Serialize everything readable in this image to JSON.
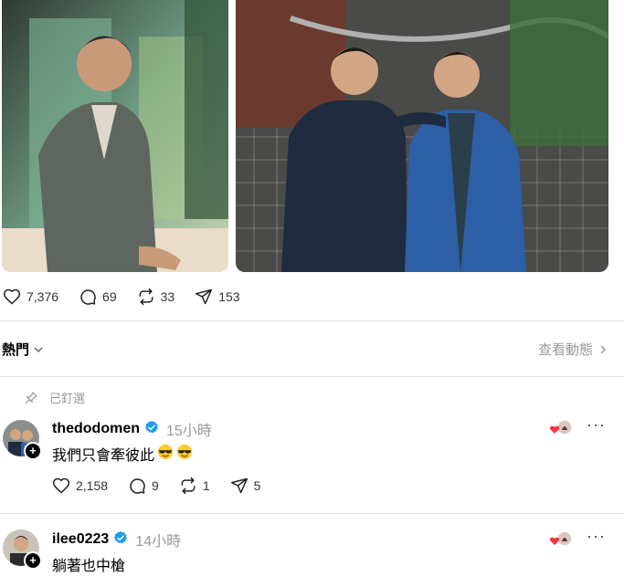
{
  "post": {
    "images": [
      {
        "alt_icon": "photo-man-gray-blazer"
      },
      {
        "alt_icon": "photo-two-men-brick-wall"
      }
    ],
    "actions": {
      "likes": "7,376",
      "comments": "69",
      "reposts": "33",
      "shares": "153"
    }
  },
  "replies_header": {
    "sort_label": "熱門",
    "view_activity_label": "查看動態"
  },
  "pinned": {
    "label": "已釘選"
  },
  "comments": [
    {
      "username": "thedodomen",
      "time": "15小時",
      "text": "我們只會牽彼此",
      "emojis": [
        "sunglasses-face",
        "sunglasses-face"
      ],
      "actions": {
        "likes": "2,158",
        "comments": "9",
        "reposts": "1",
        "shares": "5"
      }
    },
    {
      "username": "ilee0223",
      "time": "14小時",
      "text": "躺著也中槍"
    }
  ],
  "colors": {
    "verified": "#1d9bf0",
    "heart": "#ff3040",
    "muted": "#999999",
    "divider": "#e2e2e2"
  }
}
